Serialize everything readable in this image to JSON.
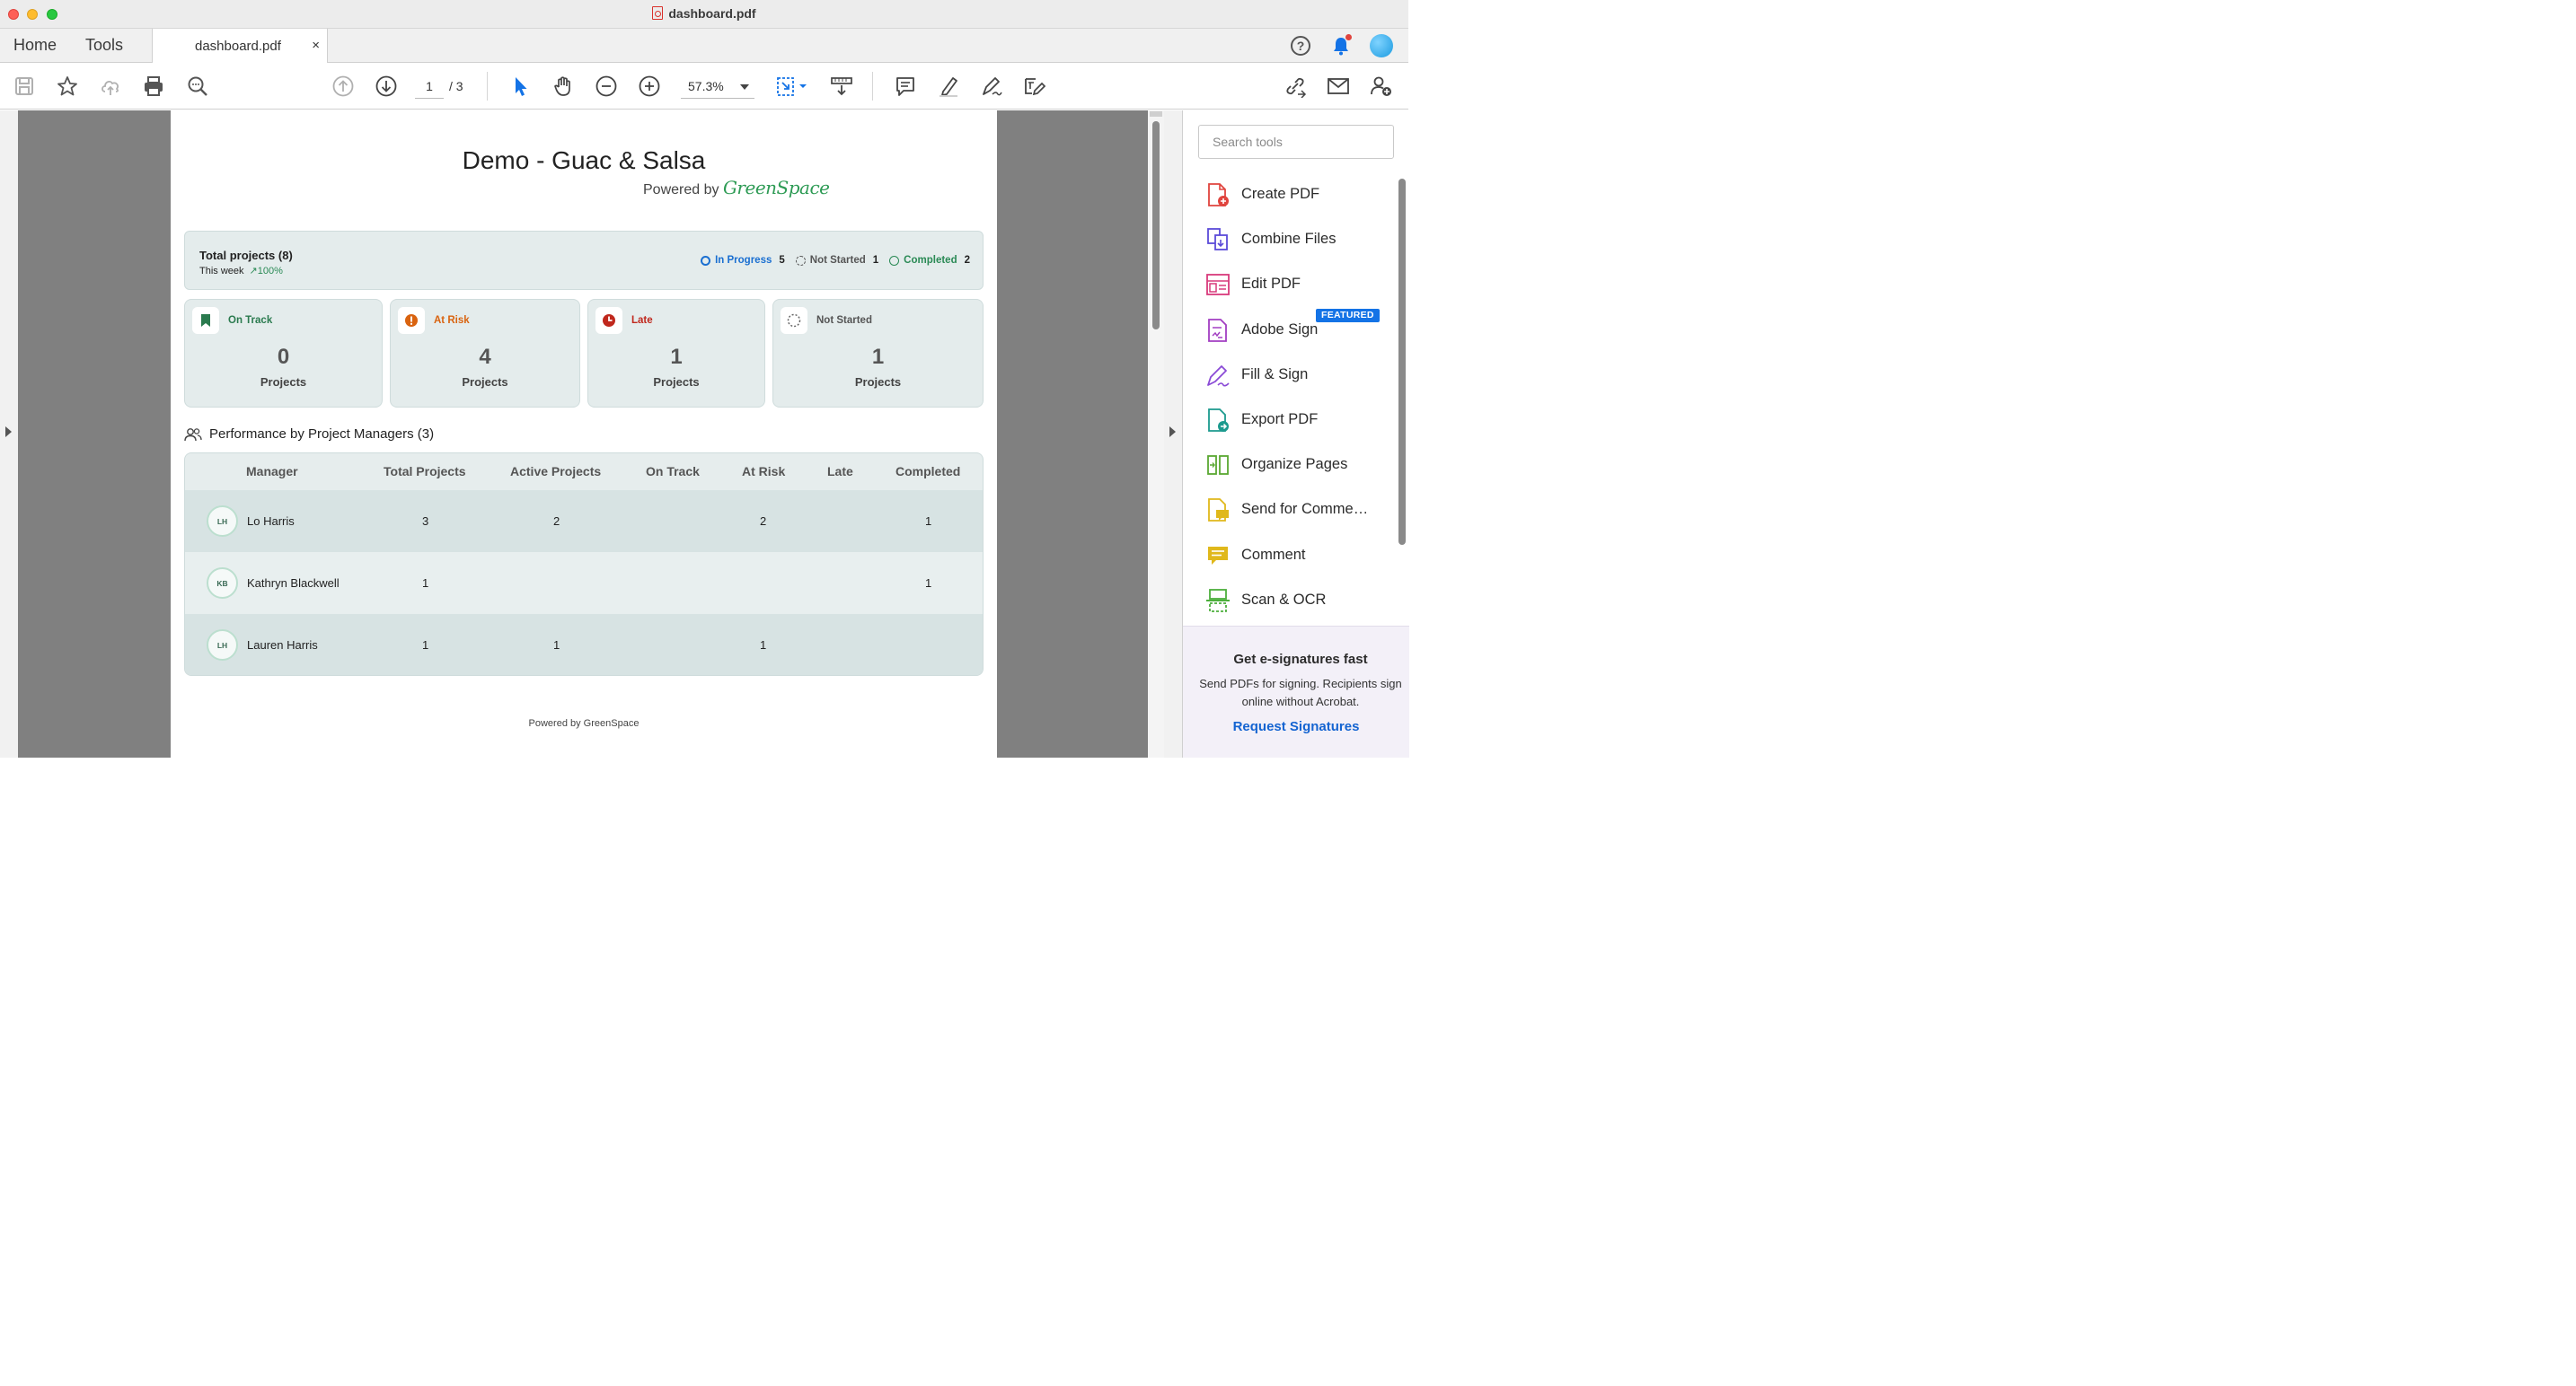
{
  "window": {
    "title": "dashboard.pdf"
  },
  "tabs": {
    "home": "Home",
    "tools": "Tools",
    "document": "dashboard.pdf",
    "close": "×"
  },
  "toolbar": {
    "current_page": "1",
    "page_total": "/ 3",
    "zoom": "57.3%"
  },
  "document": {
    "title": "Demo - Guac & Salsa",
    "powered_prefix": "Powered by",
    "powered_logo": "GreenSpace",
    "summary": {
      "title": "Total projects (8)",
      "week_label": "This week",
      "week_change": "↗100%",
      "legend": [
        {
          "label": "In Progress",
          "count": "5",
          "color": "#1a6fd1"
        },
        {
          "label": "Not Started",
          "count": "1",
          "color": "#555555"
        },
        {
          "label": "Completed",
          "count": "2",
          "color": "#2a8a55"
        }
      ]
    },
    "cards": [
      {
        "label": "On Track",
        "value": "0",
        "unit": "Projects",
        "color": "#2a7a4e"
      },
      {
        "label": "At Risk",
        "value": "4",
        "unit": "Projects",
        "color": "#d9630f"
      },
      {
        "label": "Late",
        "value": "1",
        "unit": "Projects",
        "color": "#c0281d"
      },
      {
        "label": "Not Started",
        "value": "1",
        "unit": "Projects",
        "color": "#555555"
      }
    ],
    "performance_title": "Performance by Project Managers (3)",
    "table": {
      "headers": [
        "Manager",
        "Total Projects",
        "Active Projects",
        "On Track",
        "At Risk",
        "Late",
        "Completed"
      ],
      "rows": [
        {
          "initials": "LH",
          "name": "Lo Harris",
          "total": "3",
          "active": "2",
          "on_track": "",
          "at_risk": "2",
          "late": "",
          "completed": "1"
        },
        {
          "initials": "KB",
          "name": "Kathryn Blackwell",
          "total": "1",
          "active": "",
          "on_track": "",
          "at_risk": "",
          "late": "",
          "completed": "1"
        },
        {
          "initials": "LH",
          "name": "Lauren Harris",
          "total": "1",
          "active": "1",
          "on_track": "",
          "at_risk": "1",
          "late": "",
          "completed": ""
        }
      ]
    },
    "footer": "Powered by GreenSpace"
  },
  "tools_panel": {
    "search_placeholder": "Search tools",
    "featured_badge": "FEATURED",
    "items": [
      {
        "label": "Create PDF",
        "icon": "create-pdf-icon",
        "color": "#e0443e"
      },
      {
        "label": "Combine Files",
        "icon": "combine-files-icon",
        "color": "#5b4bd8"
      },
      {
        "label": "Edit PDF",
        "icon": "edit-pdf-icon",
        "color": "#d83a7c"
      },
      {
        "label": "Adobe Sign",
        "icon": "adobe-sign-icon",
        "color": "#a23ec2"
      },
      {
        "label": "Fill & Sign",
        "icon": "fill-sign-icon",
        "color": "#8a4ad6"
      },
      {
        "label": "Export PDF",
        "icon": "export-pdf-icon",
        "color": "#1c9a8e"
      },
      {
        "label": "Organize Pages",
        "icon": "organize-pages-icon",
        "color": "#5aa832"
      },
      {
        "label": "Send for Comme…",
        "icon": "send-for-comment-icon",
        "color": "#e0b81b"
      },
      {
        "label": "Comment",
        "icon": "comment-icon",
        "color": "#e0b81b"
      },
      {
        "label": "Scan & OCR",
        "icon": "scan-ocr-icon",
        "color": "#4caf3c"
      }
    ],
    "promo": {
      "title": "Get e-signatures fast",
      "text": "Send PDFs for signing. Recipients sign online without Acrobat.",
      "link": "Request Signatures"
    }
  }
}
